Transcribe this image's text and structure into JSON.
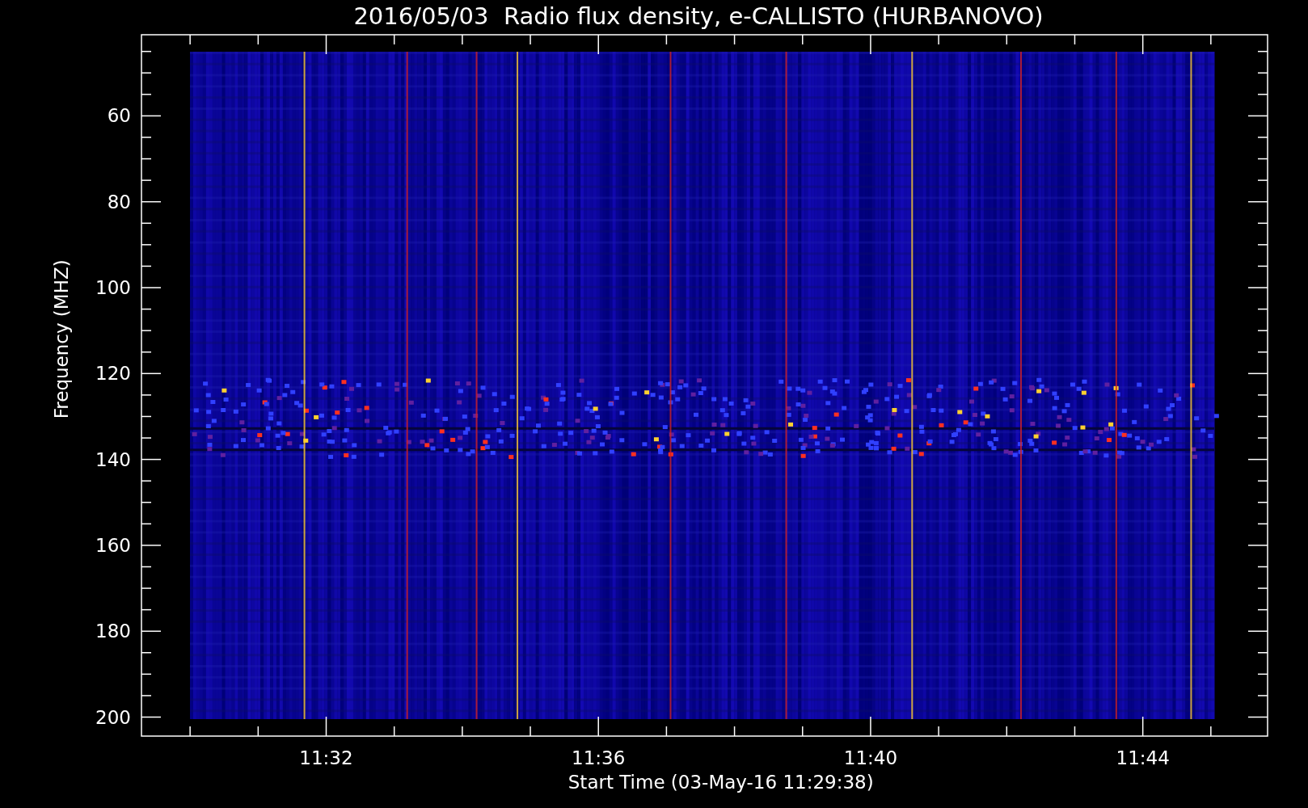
{
  "title": "2016/05/03  Radio flux density, e-CALLISTO (HURBANOVO)",
  "y_axis": {
    "label": "Frequency (MHZ)",
    "ticks": [
      "60",
      "80",
      "100",
      "120",
      "140",
      "160",
      "180",
      "200"
    ]
  },
  "x_axis": {
    "label": "Start Time (03-May-16 11:29:38)",
    "ticks": [
      "11:32",
      "11:36",
      "11:40",
      "11:44"
    ]
  }
}
